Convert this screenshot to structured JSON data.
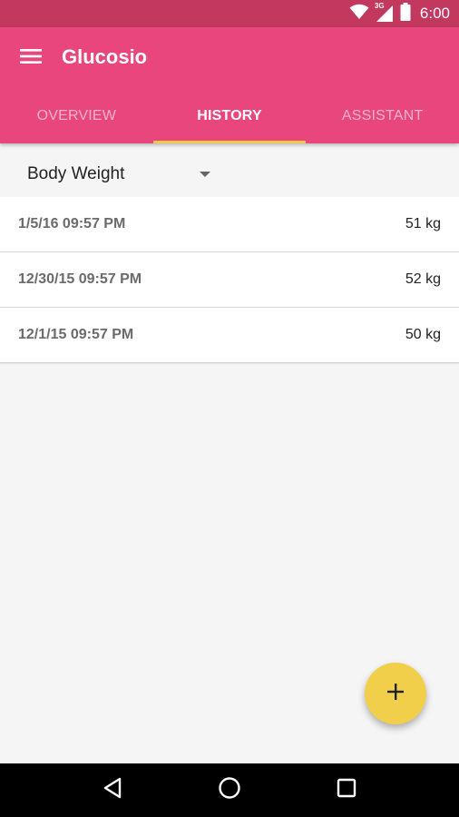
{
  "status_bar": {
    "network_label": "3G",
    "time": "6:00",
    "icons": [
      "wifi-icon",
      "cell-signal-icon",
      "battery-icon"
    ]
  },
  "app_bar": {
    "title": "Glucosio",
    "menu_icon": "hamburger-menu-icon",
    "color": "#e8467c",
    "status_color": "#c2385f"
  },
  "tabs": [
    {
      "label": "OVERVIEW",
      "active": false
    },
    {
      "label": "HISTORY",
      "active": true
    },
    {
      "label": "ASSISTANT",
      "active": false
    }
  ],
  "tab_indicator_color": "#f2c94c",
  "spinner": {
    "selected": "Body Weight",
    "icon": "dropdown-arrow-icon"
  },
  "history": [
    {
      "date": "1/5/16 09:57 PM",
      "value": "51 kg"
    },
    {
      "date": "12/30/15 09:57 PM",
      "value": "52 kg"
    },
    {
      "date": "12/1/15 09:57 PM",
      "value": "50 kg"
    }
  ],
  "fab": {
    "icon": "plus-icon",
    "color": "#f2cf4a"
  },
  "nav_bar": {
    "icons": [
      "back-icon",
      "home-icon",
      "recents-icon"
    ]
  }
}
